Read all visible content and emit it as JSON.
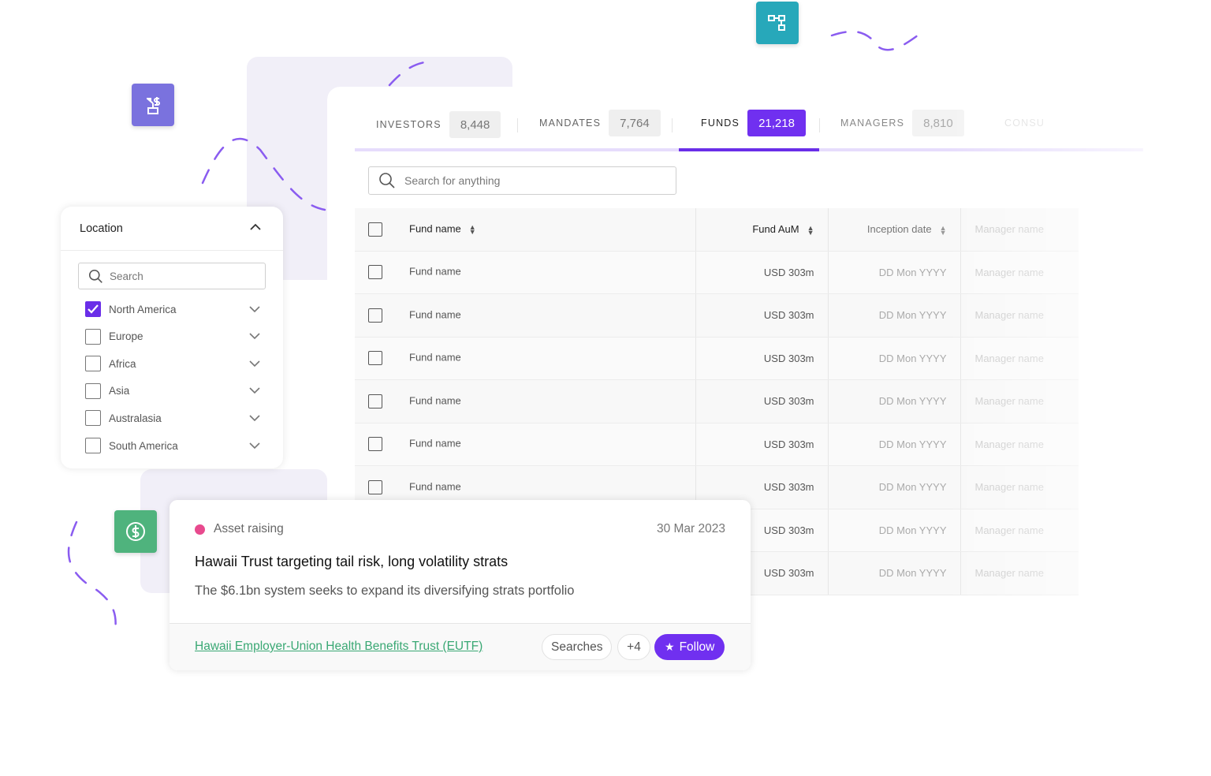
{
  "colors": {
    "accent": "#7030f0",
    "teal": "#27a8ba",
    "green": "#4fb37d",
    "purple_icon": "#7a72de",
    "dot": "#e84a8e",
    "link": "#3aa874"
  },
  "icons": [
    "plant-dollar-icon",
    "hierarchy-icon",
    "dollar-circle-icon"
  ],
  "tabs": [
    {
      "label": "INVESTORS",
      "count": "8,448"
    },
    {
      "label": "MANDATES",
      "count": "7,764"
    },
    {
      "label": "FUNDS",
      "count": "21,218",
      "active": true
    },
    {
      "label": "MANAGERS",
      "count": "8,810"
    },
    {
      "label": "CONSU"
    }
  ],
  "search": {
    "placeholder": "Search for anything"
  },
  "table": {
    "headers": [
      "Fund name",
      "Fund AuM",
      "Inception date",
      "Manager name"
    ],
    "rows": [
      [
        "Fund name",
        "USD 303m",
        "DD Mon YYYY",
        "Manager name"
      ],
      [
        "Fund name",
        "USD 303m",
        "DD Mon YYYY",
        "Manager name"
      ],
      [
        "Fund name",
        "USD 303m",
        "DD Mon YYYY",
        "Manager name"
      ],
      [
        "Fund name",
        "USD 303m",
        "DD Mon YYYY",
        "Manager name"
      ],
      [
        "Fund name",
        "USD 303m",
        "DD Mon YYYY",
        "Manager name"
      ],
      [
        "Fund name",
        "USD 303m",
        "DD Mon YYYY",
        "Manager name"
      ],
      [
        "Fund name",
        "USD 303m",
        "DD Mon YYYY",
        "Manager name"
      ],
      [
        "Fund name",
        "USD 303m",
        "DD Mon YYYY",
        "Manager name"
      ]
    ]
  },
  "location": {
    "title": "Location",
    "search_placeholder": "Search",
    "items": [
      {
        "label": "North America",
        "checked": true
      },
      {
        "label": "Europe",
        "checked": false
      },
      {
        "label": "Africa",
        "checked": false
      },
      {
        "label": "Asia",
        "checked": false
      },
      {
        "label": "Australasia",
        "checked": false
      },
      {
        "label": "South America",
        "checked": false
      }
    ]
  },
  "card": {
    "tag": "Asset raising",
    "date": "30 Mar 2023",
    "title": "Hawaii Trust targeting tail risk, long volatility strats",
    "body": "The $6.1bn system seeks to expand its diversifying strats portfolio",
    "link": "Hawaii Employer-Union Health Benefits Trust (EUTF)",
    "searches": "Searches",
    "more": "+4",
    "follow": "Follow"
  }
}
